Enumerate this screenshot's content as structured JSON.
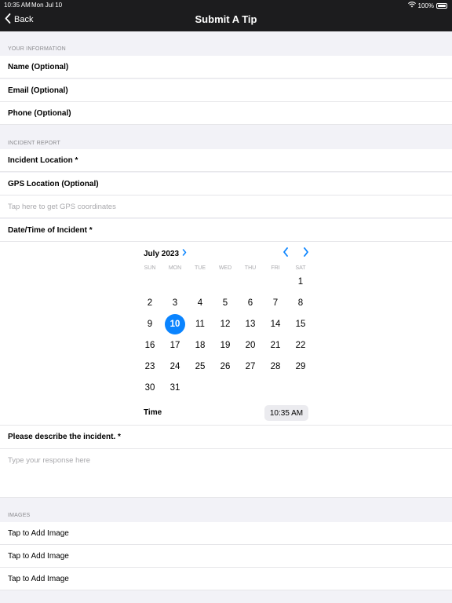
{
  "status": {
    "time": "10:35 AM",
    "date": "Mon Jul 10",
    "battery": "100%"
  },
  "nav": {
    "back_label": "Back",
    "title": "Submit A Tip"
  },
  "your_info": {
    "header": "YOUR INFORMATION",
    "fields": [
      "Name (Optional)",
      "Email (Optional)",
      "Phone (Optional)"
    ]
  },
  "incident": {
    "header": "INCIDENT REPORT",
    "location_label": "Incident Location *",
    "gps_label": "GPS Location (Optional)",
    "gps_hint": "Tap here to get GPS coordinates",
    "datetime_label": "Date/Time of Incident *"
  },
  "calendar": {
    "month_label": "July 2023",
    "weekdays": [
      "SUN",
      "MON",
      "TUE",
      "WED",
      "THU",
      "FRI",
      "SAT"
    ],
    "days": [
      "1",
      "2",
      "3",
      "4",
      "5",
      "6",
      "7",
      "8",
      "9",
      "10",
      "11",
      "12",
      "13",
      "14",
      "15",
      "16",
      "17",
      "18",
      "19",
      "20",
      "21",
      "22",
      "23",
      "24",
      "25",
      "26",
      "27",
      "28",
      "29",
      "30",
      "31"
    ],
    "selected_day": "10",
    "time_label": "Time",
    "time_value": "10:35 AM",
    "accent": "#0a84ff"
  },
  "description": {
    "label": "Please describe the incident. *",
    "placeholder": "Type your response here"
  },
  "images": {
    "header": "IMAGES",
    "items": [
      "Tap to Add Image",
      "Tap to Add Image",
      "Tap to Add Image"
    ]
  }
}
